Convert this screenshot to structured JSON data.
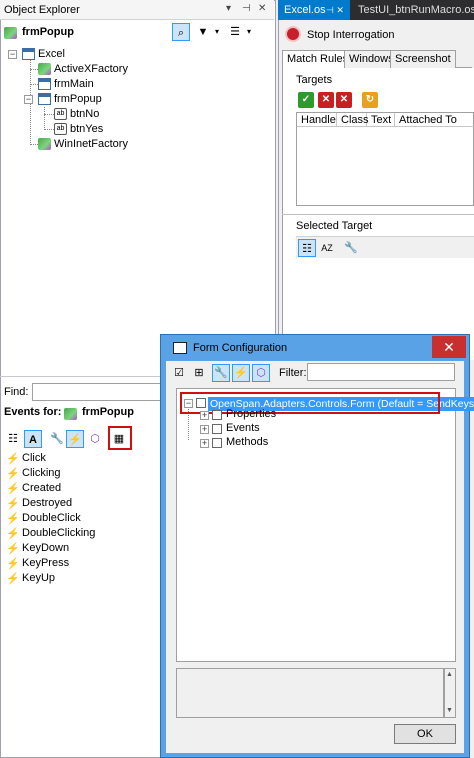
{
  "object_explorer": {
    "title": "Object Explorer",
    "pin": "▾ ⊣ ✕",
    "header": "frmPopup",
    "tree": {
      "root": "Excel",
      "items": [
        "ActiveXFactory",
        "frmMain",
        "frmPopup",
        "btnNo",
        "btnYes",
        "WinInetFactory"
      ]
    },
    "find_label": "Find:",
    "events_for_label": "Events for:",
    "events_for_target": "frmPopup",
    "events": [
      "Click",
      "Clicking",
      "Created",
      "Destroyed",
      "DoubleClick",
      "DoubleClicking",
      "KeyDown",
      "KeyPress",
      "KeyUp"
    ]
  },
  "doc_tabs": {
    "tab1": "Excel.os",
    "tab1_pin": "⊣ ✕",
    "tab2": "TestUI_btnRunMacro.os*"
  },
  "interrogator": {
    "stop_label": "Stop Interrogation",
    "tabs": [
      "Match Rules",
      "Windows",
      "Screenshot"
    ],
    "targets_label": "Targets",
    "grid_headers": [
      "Handle",
      "Class",
      "Text",
      "Attached To"
    ],
    "selected_target_label": "Selected Target"
  },
  "form_config": {
    "title": "Form Configuration",
    "close": "✕",
    "filter_label": "Filter:",
    "root_node": "OpenSpan.Adapters.Controls.Form   (Default = SendKeys)",
    "children": [
      "Properties",
      "Events",
      "Methods"
    ],
    "ok_label": "OK"
  },
  "colors": {
    "accent": "#007acc",
    "dialog_frame": "#5aa2e6",
    "highlight_border": "#d01010",
    "selection": "#3399ff"
  }
}
